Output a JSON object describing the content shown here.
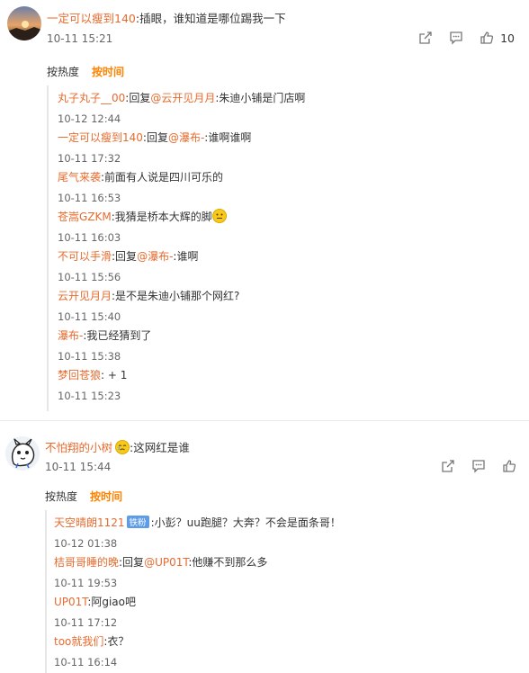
{
  "comments": [
    {
      "user": "一定可以瘦到140",
      "text": ":插眼，谁知道是哪位踢我一下",
      "time": "10-11 15:21",
      "likes": "10",
      "sort": {
        "hot": "按热度",
        "time": "按时间"
      },
      "replies": [
        {
          "user": "丸子丸子__00",
          "pre": ":回复",
          "at": "@云开见月月",
          "text": ":朱迪小铺是门店啊",
          "time": "10-12 12:44"
        },
        {
          "user": "一定可以瘦到140",
          "pre": ":回复",
          "at": "@瀑布-",
          "text": ":谁啊谁啊",
          "time": "10-11 17:32"
        },
        {
          "user": "尾气来袭",
          "pre": "",
          "at": "",
          "text": ":前面有人说是四川可乐的",
          "time": "10-11 16:53"
        },
        {
          "user": "苍嵩GZKM",
          "pre": "",
          "at": "",
          "text": ":我猜是桥本大辉的脚",
          "time": "10-11 16:03"
        },
        {
          "user": "不可以手滑",
          "pre": ":回复",
          "at": "@瀑布-",
          "text": ":谁啊",
          "time": "10-11 15:56"
        },
        {
          "user": "云开见月月",
          "pre": "",
          "at": "",
          "text": ":是不是朱迪小铺那个网红?",
          "time": "10-11 15:40"
        },
        {
          "user": "瀑布-",
          "pre": "",
          "at": "",
          "text": ":我已经猜到了",
          "time": "10-11 15:38"
        },
        {
          "user": "梦回苍狼",
          "pre": "",
          "at": "",
          "text": ": + 1",
          "time": "10-11 15:23"
        }
      ]
    },
    {
      "user": "不怕翔的小树",
      "text": ":这网红是谁",
      "time": "10-11 15:44",
      "sort": {
        "hot": "按热度",
        "time": "按时间"
      },
      "replies": [
        {
          "user": "天空晴朗1121",
          "badge": "铁粉",
          "text": ":小彭？uu跑腿？大奔？不会是面条哥！",
          "time": "10-12 01:38"
        },
        {
          "user": "桔哥哥睡的晚",
          "pre": ":回复",
          "at": "@UP01T",
          "text": ":他赚不到那么多",
          "time": "10-11 19:53"
        },
        {
          "user": "UP01T",
          "text": ":阿giao吧",
          "time": "10-11 17:12"
        },
        {
          "user": "too就我们",
          "text": ":衣？",
          "time": "10-11 16:14"
        }
      ]
    }
  ],
  "colors": {
    "username": "#e86b2e",
    "active_sort": "#ff8200",
    "badge": "#5d9ce6"
  },
  "icons": [
    "share-icon",
    "comment-icon",
    "like-icon",
    "smiley-emoji-icon"
  ]
}
